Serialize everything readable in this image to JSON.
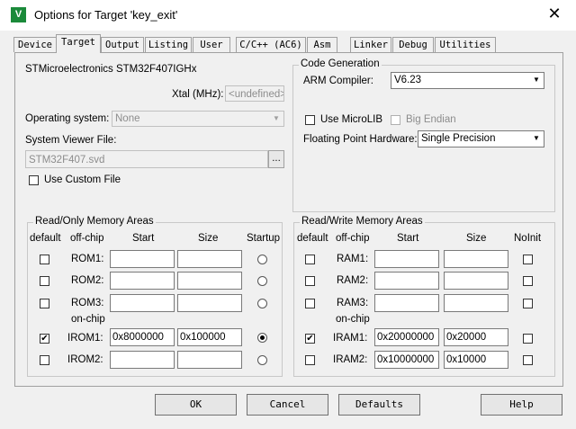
{
  "window": {
    "title": "Options for Target 'key_exit'",
    "icon": "V",
    "close": "✕"
  },
  "tabs": [
    {
      "label": "Device"
    },
    {
      "label": "Target"
    },
    {
      "label": "Output"
    },
    {
      "label": "Listing"
    },
    {
      "label": "User"
    },
    {
      "label": "C/C++ (AC6)"
    },
    {
      "label": "Asm"
    },
    {
      "label": "Linker"
    },
    {
      "label": "Debug"
    },
    {
      "label": "Utilities"
    }
  ],
  "device": {
    "name": "STMicroelectronics STM32F407IGHx",
    "xtal_label": "Xtal (MHz):",
    "xtal_value": "<undefined>",
    "os_label": "Operating system:",
    "os_value": "None",
    "svd_label": "System Viewer File:",
    "svd_value": "STM32F407.svd",
    "browse": "...",
    "custom_file_label": "Use Custom File"
  },
  "codegen": {
    "title": "Code Generation",
    "compiler_label": "ARM Compiler:",
    "compiler_value": "V6.23",
    "microlib_label": "Use MicroLIB",
    "bigendian_label": "Big Endian",
    "fp_label": "Floating Point Hardware:",
    "fp_value": "Single Precision"
  },
  "ro": {
    "title": "Read/Only Memory Areas",
    "headers": {
      "default": "default",
      "offchip": "off-chip",
      "start": "Start",
      "size": "Size",
      "startup": "Startup"
    },
    "onchip_label": "on-chip",
    "rows": [
      {
        "name": "ROM1:",
        "default": false,
        "start": "",
        "size": "",
        "startup": false
      },
      {
        "name": "ROM2:",
        "default": false,
        "start": "",
        "size": "",
        "startup": false
      },
      {
        "name": "ROM3:",
        "default": false,
        "start": "",
        "size": "",
        "startup": false
      },
      {
        "name": "IROM1:",
        "default": true,
        "start": "0x8000000",
        "size": "0x100000",
        "startup": true
      },
      {
        "name": "IROM2:",
        "default": false,
        "start": "",
        "size": "",
        "startup": false
      }
    ]
  },
  "rw": {
    "title": "Read/Write Memory Areas",
    "headers": {
      "default": "default",
      "offchip": "off-chip",
      "start": "Start",
      "size": "Size",
      "noinit": "NoInit"
    },
    "onchip_label": "on-chip",
    "rows": [
      {
        "name": "RAM1:",
        "default": false,
        "start": "",
        "size": "",
        "noinit": false
      },
      {
        "name": "RAM2:",
        "default": false,
        "start": "",
        "size": "",
        "noinit": false
      },
      {
        "name": "RAM3:",
        "default": false,
        "start": "",
        "size": "",
        "noinit": false
      },
      {
        "name": "IRAM1:",
        "default": true,
        "start": "0x20000000",
        "size": "0x20000",
        "noinit": false
      },
      {
        "name": "IRAM2:",
        "default": false,
        "start": "0x10000000",
        "size": "0x10000",
        "noinit": false
      }
    ]
  },
  "buttons": {
    "ok": "OK",
    "cancel": "Cancel",
    "defaults": "Defaults",
    "help": "Help"
  }
}
